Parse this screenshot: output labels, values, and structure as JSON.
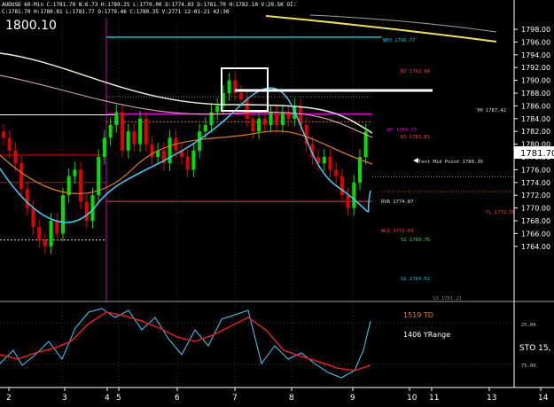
{
  "header": {
    "symbol_line": "AUDUSD 60-Min C:1781.70 N:6.73 H:1789.25 L:1770.00 O:1774.03 D:1781.70 H:1782.10 V:29.5K OI:",
    "sub_line": "C:1781.70 H:1780.81 L:1781.77 O:1779.46 C:1780.35 V:2771 12-01-21 42:30",
    "big_label": "1800.10"
  },
  "price_axis": {
    "ticks": [
      "1798.00",
      "1796.00",
      "1794.00",
      "1792.00",
      "1790.00",
      "1788.00",
      "1786.00",
      "1784.00",
      "1782.00",
      "1780.00",
      "1778.00",
      "1776.00",
      "1774.00",
      "1772.00",
      "1770.00",
      "1768.00",
      "1766.00",
      "1764.00"
    ],
    "last_price": "1781.70"
  },
  "time_axis": {
    "ticks": [
      "2",
      "3",
      "4",
      "5",
      "6",
      "7",
      "8",
      "9",
      "10",
      "11",
      "13",
      "14"
    ]
  },
  "levels": {
    "wh3": "WH3 1796.77",
    "r2": "R2 1792.84",
    "yh": "YH 1787.42",
    "wp": "WP 1784.73",
    "r1": "R1 1783.81",
    "mid": "Test Mid Point 1780.39",
    "rvr": "RVR 1774.87",
    "yl": "YL 1772.58",
    "wl3": "WL3 1771.03",
    "s1": "S1 1769.75",
    "s2": "S2 1764.52",
    "s3": "S3 1761.21"
  },
  "indicator": {
    "td": "1519 TD",
    "yrange": "1406 YRange",
    "sto_label": "STO 15,",
    "levels": [
      "25.00",
      "75.00"
    ]
  },
  "colors": {
    "background": "#000000",
    "up": "#00e000",
    "down": "#e00000",
    "axis": "#ffffff",
    "level_cyan": "#00c8e0",
    "level_magenta": "#e000e0",
    "ma_white": "#e8f0d8",
    "ma_orange": "#e07a20",
    "ma_cyan": "#40d0ff",
    "ma_pink": "#f0b0c0"
  }
}
